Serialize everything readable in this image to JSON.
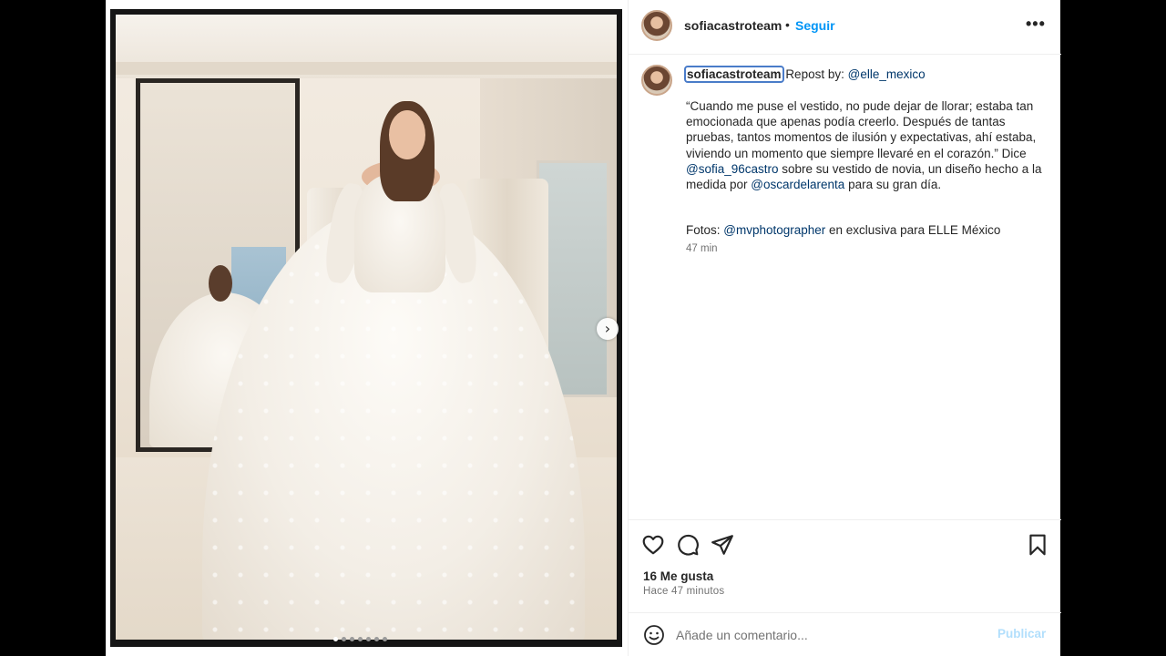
{
  "post": {
    "username": "sofiacastroteam",
    "separator": "•",
    "follow_label": "Seguir",
    "more_label": "•••"
  },
  "caption": {
    "username": "sofiacastroteam",
    "repost_label": "Repost by:",
    "repost_mention": "@elle_mexico",
    "body": {
      "part1": "“Cuando me puse el vestido, no pude dejar de llorar; estaba tan emocionada que apenas podía creerlo. Después de tantas pruebas, tantos momentos de ilusión y expectativas, ahí estaba, viviendo un momento que siempre llevaré en el corazón.” Dice ",
      "mention1": "@sofia_96castro",
      "part2": " sobre su vestido de novia, un diseño hecho a la medida por ",
      "mention2": "@oscardelarenta",
      "part3": " para su gran día."
    },
    "credits": {
      "prefix": "Fotos: ",
      "mention": "@mvphotographer",
      "suffix": " en exclusiva para ELLE México"
    },
    "time": "47 min"
  },
  "actions": {
    "icons": [
      "heart-icon",
      "comment-icon",
      "share-icon",
      "bookmark-icon"
    ],
    "likes": "16 Me gusta",
    "posted_ago": "Hace 47 minutos"
  },
  "comment": {
    "placeholder": "Añade un comentario...",
    "publish_label": "Publicar"
  },
  "media": {
    "next_label": "›",
    "slide_count": 7,
    "active_slide": 1
  },
  "colors": {
    "link": "#0095f6",
    "mention": "#00376b",
    "publish_disabled": "#b2dffc",
    "background": "#000000"
  }
}
